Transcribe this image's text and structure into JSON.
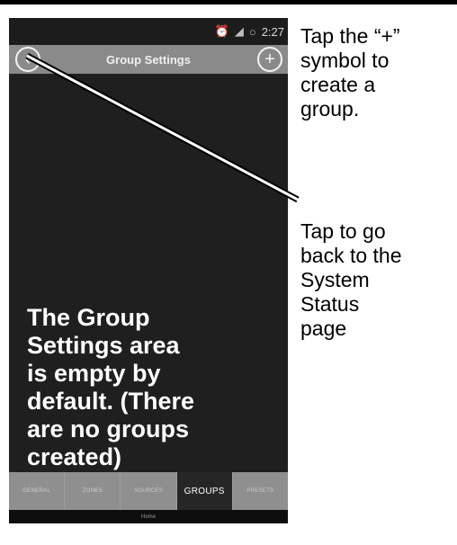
{
  "status_bar": {
    "time": "2:27"
  },
  "header": {
    "title": "Group Settings",
    "back_glyph": "‹",
    "add_glyph": "+"
  },
  "content": {
    "empty_note": "The Group\nSettings area\nis empty by\ndefault. (There\nare no groups\ncreated)"
  },
  "tabs": [
    "GENERAL",
    "ZONES",
    "SOURCES",
    "GROUPS",
    "PRESETS"
  ],
  "active_tab": "GROUPS",
  "nav": {
    "home_label": "Home"
  },
  "callouts": {
    "plus": "Tap the “+”\nsymbol to\ncreate a\ngroup.",
    "back": "Tap to go\nback to the\nSystem\nStatus\npage"
  }
}
